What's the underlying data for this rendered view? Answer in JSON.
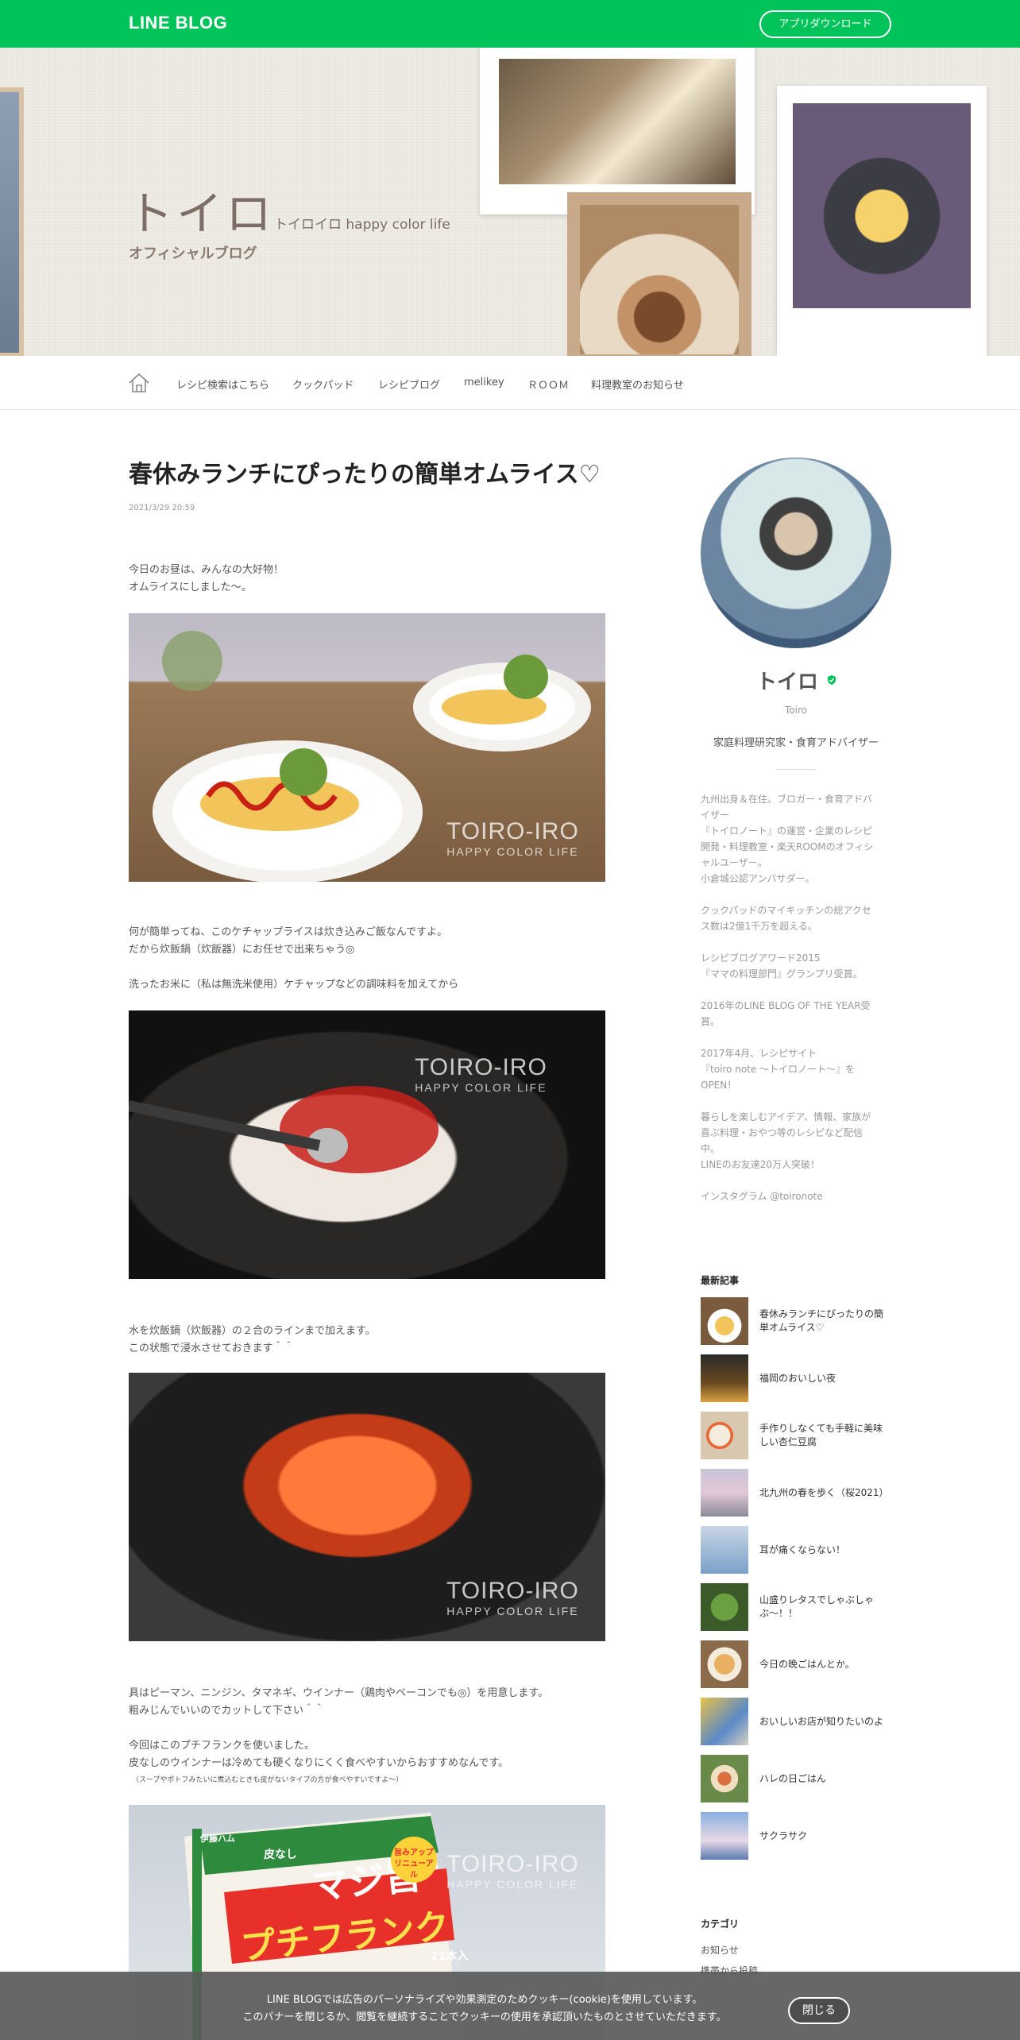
{
  "topbar": {
    "logo": "LINE BLOG",
    "app_download": "アプリダウンロード",
    "brand_color": "#00c35a"
  },
  "header": {
    "title": "トイロ",
    "subtitle": "トイロイロ happy color life",
    "official": "オフィシャルブログ"
  },
  "nav": {
    "items": [
      "レシピ検索はこちら",
      "クックパッド",
      "レシピブログ",
      "melikey",
      "ＲＯＯＭ",
      "料理教室のお知らせ"
    ]
  },
  "post": {
    "title": "春休みランチにぴったりの簡単オムライス♡",
    "date": "2021/3/29 20:59",
    "paragraphs": [
      "今日のお昼は、みんなの大好物！",
      "オムライスにしました〜。",
      "何が簡単ってね、このケチャップライスは炊き込みご飯なんですよ。",
      "だから炊飯鍋（炊飯器）にお任せで出来ちゃう◎",
      "洗ったお米に（私は無洗米使用）ケチャップなどの調味料を加えてから",
      "水を炊飯鍋（炊飯器）の２合のラインまで加えます。",
      "この状態で浸水させておきます＾＾",
      "具はピーマン、ニンジン、タマネギ、ウインナー（鶏肉やベーコンでも◎）を用意します。",
      "粗みじんでいいのでカットして下さい＾＾",
      "今回はこのプチフランクを使いました。",
      "皮なしのウインナーは冷めても硬くなりにくく食べやすいからおすすめなんです。",
      "（スープやポトフみたいに煮込むときも皮がないタイプの方が食べやすいですよ〜）"
    ],
    "watermark": {
      "main": "TOIRO-IRO",
      "sub": "HAPPY COLOR LIFE"
    },
    "package_text": {
      "brand": "皮なし",
      "product": "マジ旨",
      "name": "プチフランク",
      "badge": "旨みアップ リニューアル",
      "maker": "伊藤ハム",
      "count": "21本入"
    }
  },
  "profile": {
    "name": "トイロ",
    "roman": "Toiro",
    "role": "家庭料理研究家・食育アドバイザー",
    "bio": [
      "九州出身＆在住。ブロガー・食育アドバ",
      "イザー",
      "『トイロノート』の運営・企業のレシピ",
      "開発・料理教室・楽天ROOMのオフィシ",
      "ャルユーザー。",
      "小倉城公認アンバサダー。",
      "クックパッドのマイキッチンの総アクセ",
      "ス数は2億1千万を超える。",
      "レシピブログアワード2015",
      "『ママの料理部門』グランプリ受賞。",
      "2016年のLINE BLOG OF THE YEAR受",
      "賞。",
      "2017年4月、レシピサイト",
      "『toiro note 〜トイロノート〜』を",
      "OPEN！",
      "暮らしを楽しむアイデア、情報、家族が",
      "喜ぶ料理・おやつ等のレシピなど配信",
      "中。",
      "LINEのお友達20万人突破！",
      "インスタグラム @toironote"
    ]
  },
  "recent": {
    "heading": "最新記事",
    "items": [
      "春休みランチにぴったりの簡単オムライス♡",
      "福岡のおいしい夜",
      "手作りしなくても手軽に美味しい杏仁豆腐",
      "北九州の春を歩く（桜2021）",
      "耳が痛くならない！",
      "山盛りレタスでしゃぶしゃぶ〜！！",
      "今日の晩ごはんとか。",
      "おいしいお店が知りたいのよ",
      "ハレの日ごはん",
      "サクラサク"
    ]
  },
  "categories": {
    "heading": "カテゴリ",
    "items": [
      "お知らせ",
      "携帯から投稿"
    ]
  },
  "cookie": {
    "line1": "LINE BLOGでは広告のパーソナライズや効果測定のためクッキー(cookie)を使用しています。",
    "line2": "このバナーを閉じるか、閲覧を継続することでクッキーの使用を承認頂いたものとさせていただきます。",
    "close": "閉じる"
  }
}
